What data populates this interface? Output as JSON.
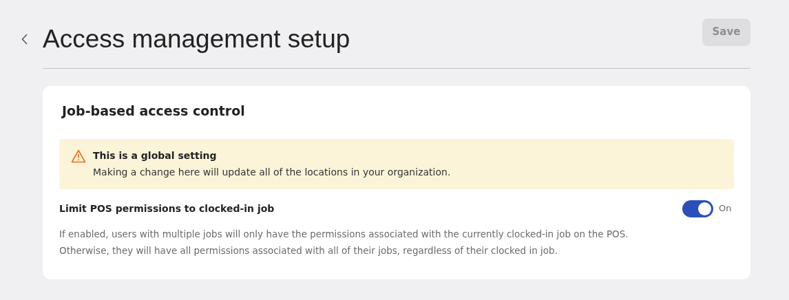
{
  "header": {
    "title": "Access management setup",
    "save_button": {
      "label": "Save",
      "disabled": true
    }
  },
  "card": {
    "title": "Job-based access control",
    "banner": {
      "title": "This is a global setting",
      "message": "Making a change here will update all of the locations in your organization."
    },
    "setting": {
      "label": "Limit POS permissions to clocked-in job",
      "on": true,
      "state_label": "On",
      "description": "If enabled, users with multiple jobs will only have the permissions associated with the currently clocked-in job on the POS.\nOtherwise, they will have all permissions associated with all of their jobs, regardless of their clocked in job."
    }
  }
}
